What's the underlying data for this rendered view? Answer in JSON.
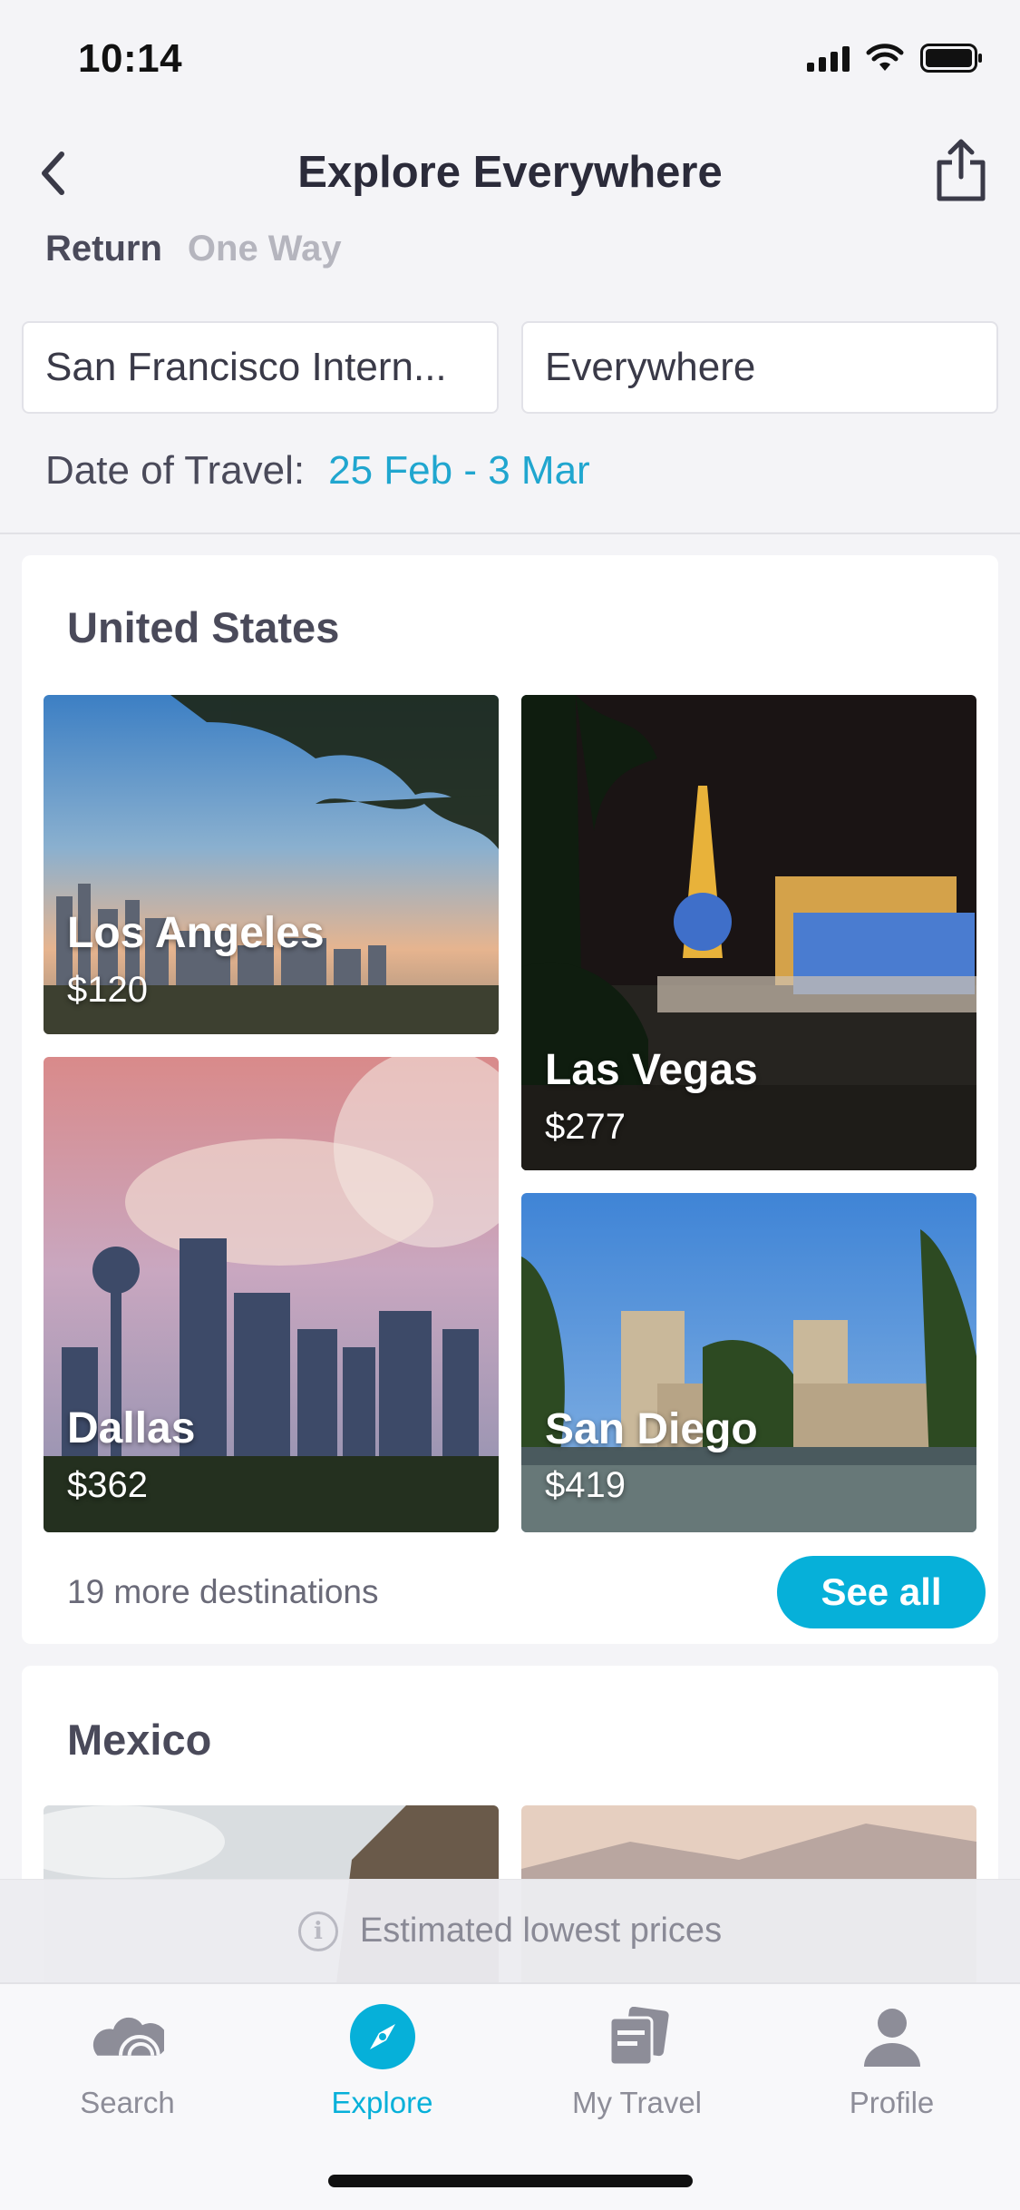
{
  "status_bar": {
    "time": "10:14"
  },
  "nav": {
    "title": "Explore Everywhere"
  },
  "trip_type": {
    "return_label": "Return",
    "oneway_label": "One Way"
  },
  "search": {
    "from_value": "San Francisco Intern...",
    "to_value": "Everywhere",
    "date_label": "Date of Travel:",
    "date_value": "25 Feb - 3 Mar"
  },
  "sections": [
    {
      "title": "United States",
      "destinations": [
        {
          "name": "Los Angeles",
          "price": "$120"
        },
        {
          "name": "Las Vegas",
          "price": "$277"
        },
        {
          "name": "Dallas",
          "price": "$362"
        },
        {
          "name": "San Diego",
          "price": "$419"
        }
      ],
      "more_text": "19 more destinations",
      "see_all_label": "See all"
    },
    {
      "title": "Mexico"
    }
  ],
  "estimate_banner": {
    "text": "Estimated lowest prices",
    "icon": "info-icon"
  },
  "tabs": [
    {
      "label": "Search",
      "icon": "search-cloud-icon"
    },
    {
      "label": "Explore",
      "icon": "compass-icon",
      "active": true
    },
    {
      "label": "My Travel",
      "icon": "cards-icon"
    },
    {
      "label": "Profile",
      "icon": "person-icon"
    }
  ],
  "colors": {
    "accent": "#06b0d9",
    "date_text": "#20a6cf",
    "title_text": "#2b2b3a"
  }
}
